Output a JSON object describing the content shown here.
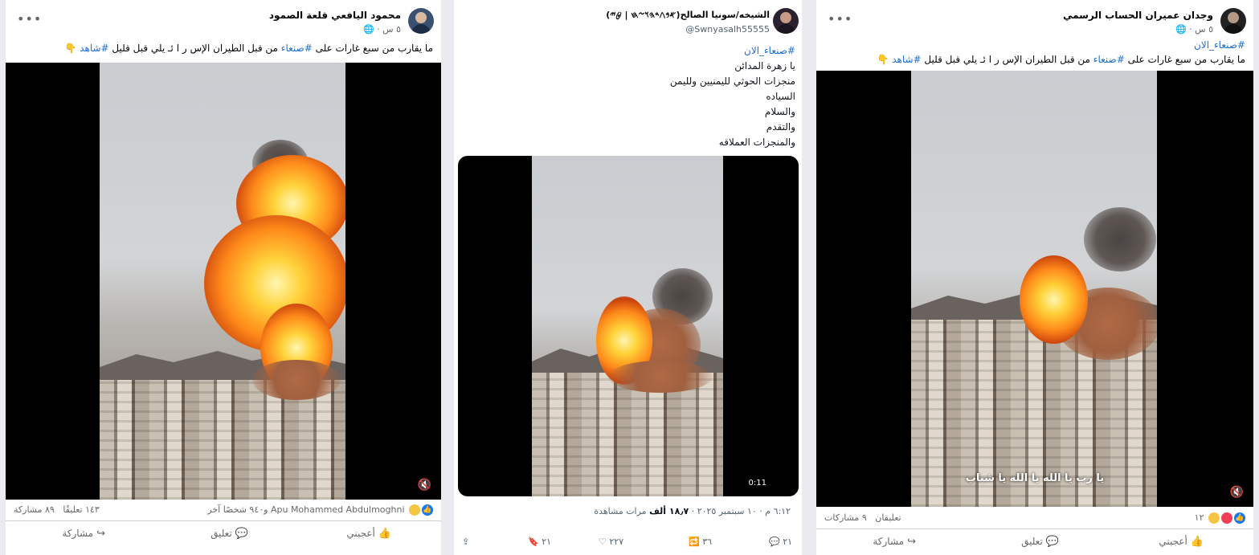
{
  "left_post": {
    "author": "محمود اليافعي قلعة الصمود",
    "time": "٥ س",
    "caption_pre": "ما يقارب من سبع غارات على ",
    "caption_tag1": "#صنعاء",
    "caption_mid": " من قبل الطيران الإس ر ا ئـ يلي قبل قليل ",
    "caption_tag2": "#شاهد",
    "caption_emoji": " 👇",
    "reactions_text": "Apu Mohammed Abdulmoghni و٩٤٠ شخصًا آخر",
    "comments": "١٤٣ تعليقًا",
    "shares": "٨٩ مشاركة",
    "like_label": "أعجبني",
    "comment_label": "تعليق",
    "share_label": "مشاركة"
  },
  "middle_post": {
    "author": "الشيخه/سونيا الصالح(𐤀𐤁𐤂𐤃𐤄𐤅𐤆𐤇 | 𐤈𐤉)",
    "handle": "@Swnyasalh55555",
    "lines": [
      "#صنعاء_الان",
      "يا زهرة المدائن",
      "منجزات الحوثي لليمنيين ولليمن",
      "السياده",
      "والسلام",
      "والتقدم",
      "والمنجزات العملاقه"
    ],
    "video_duration": "0:11",
    "timestamp": "٦:١٢ م · ١٠ سبتمبر ٢٠٢٥ · ",
    "views": "١٨٫٧ ألف",
    "views_label": " مرات مشاهدة",
    "replies": "٢١",
    "retweets": "٣٦",
    "likes": "٢٢٧",
    "bookmarks": "٢١"
  },
  "right_post": {
    "author": "وجدان عميران الحساب الرسمي",
    "time": "٥ س",
    "tag_line": "#صنعاء_الان",
    "caption_pre": "ما يقارب من سبع غارات على ",
    "caption_tag1": "#صنعاء",
    "caption_mid": " من قبل الطيران الإس ر ا ئـ يلي قبل قليل ",
    "caption_tag2": "#شاهد",
    "caption_emoji": " 👇",
    "subtitle": "يا رب يا الله يا الله يا شباب",
    "reactions_count": "١٢",
    "comments": "تعليقان",
    "shares": "٩ مشاركات",
    "like_label": "أعجبني",
    "comment_label": "تعليق",
    "share_label": "مشاركة"
  }
}
